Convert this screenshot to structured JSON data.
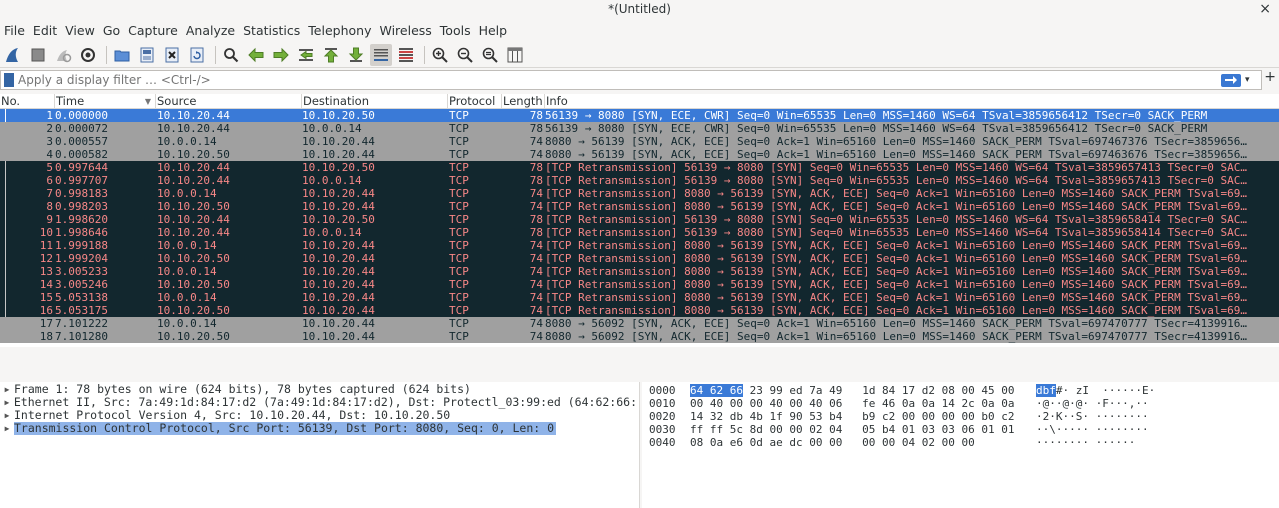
{
  "window": {
    "title": "*(Untitled)",
    "close": "×"
  },
  "menu": [
    "File",
    "Edit",
    "View",
    "Go",
    "Capture",
    "Analyze",
    "Statistics",
    "Telephony",
    "Wireless",
    "Tools",
    "Help"
  ],
  "toolbar": {
    "icons": [
      "shark-fin-start-icon",
      "stop-square-icon",
      "restart-capture-icon",
      "capture-options-gear-icon",
      "open-folder-icon",
      "save-file-icon",
      "close-file-icon",
      "reload-file-icon",
      "find-packet-icon",
      "go-back-arrow-icon",
      "go-forward-arrow-icon",
      "go-to-packet-icon",
      "go-first-packet-icon",
      "go-last-packet-icon",
      "auto-scroll-icon",
      "colorize-list-icon",
      "zoom-in-icon",
      "zoom-out-icon",
      "zoom-normal-icon",
      "resize-columns-icon"
    ]
  },
  "filter": {
    "placeholder": "Apply a display filter … <Ctrl-/>",
    "plus": "+"
  },
  "columns": {
    "no": "No.",
    "time": "Time",
    "source": "Source",
    "destination": "Destination",
    "protocol": "Protocol",
    "length": "Length",
    "info": "Info"
  },
  "colors": {
    "selected_bg": "#3a7ad7",
    "normal_bg": "#a0a0a0",
    "bad_bg": "#12272e",
    "bad_fg": "#f78787"
  },
  "packets": [
    {
      "no": "1",
      "time": "0.000000",
      "src": "10.10.20.44",
      "dst": "10.10.20.50",
      "proto": "TCP",
      "len": "78",
      "info": "56139 → 8080 [SYN, ECE, CWR] Seq=0 Win=65535 Len=0 MSS=1460 WS=64 TSval=3859656412 TSecr=0 SACK_PERM",
      "style": "selected"
    },
    {
      "no": "2",
      "time": "0.000072",
      "src": "10.10.20.44",
      "dst": "10.0.0.14",
      "proto": "TCP",
      "len": "78",
      "info": "56139 → 8080 [SYN, ECE, CWR] Seq=0 Win=65535 Len=0 MSS=1460 WS=64 TSval=3859656412 TSecr=0 SACK_PERM",
      "style": "normal"
    },
    {
      "no": "3",
      "time": "0.000557",
      "src": "10.0.0.14",
      "dst": "10.10.20.44",
      "proto": "TCP",
      "len": "74",
      "info": "8080 → 56139 [SYN, ACK, ECE] Seq=0 Ack=1 Win=65160 Len=0 MSS=1460 SACK_PERM TSval=697467376 TSecr=3859656…",
      "style": "normal"
    },
    {
      "no": "4",
      "time": "0.000582",
      "src": "10.10.20.50",
      "dst": "10.10.20.44",
      "proto": "TCP",
      "len": "74",
      "info": "8080 → 56139 [SYN, ACK, ECE] Seq=0 Ack=1 Win=65160 Len=0 MSS=1460 SACK_PERM TSval=697463676 TSecr=3859656…",
      "style": "normal"
    },
    {
      "no": "5",
      "time": "0.997644",
      "src": "10.10.20.44",
      "dst": "10.10.20.50",
      "proto": "TCP",
      "len": "78",
      "info": "[TCP Retransmission] 56139 → 8080 [SYN] Seq=0 Win=65535 Len=0 MSS=1460 WS=64 TSval=3859657413 TSecr=0 SAC…",
      "style": "bad"
    },
    {
      "no": "6",
      "time": "0.997707",
      "src": "10.10.20.44",
      "dst": "10.0.0.14",
      "proto": "TCP",
      "len": "78",
      "info": "[TCP Retransmission] 56139 → 8080 [SYN] Seq=0 Win=65535 Len=0 MSS=1460 WS=64 TSval=3859657413 TSecr=0 SAC…",
      "style": "bad"
    },
    {
      "no": "7",
      "time": "0.998183",
      "src": "10.0.0.14",
      "dst": "10.10.20.44",
      "proto": "TCP",
      "len": "74",
      "info": "[TCP Retransmission] 8080 → 56139 [SYN, ACK, ECE] Seq=0 Ack=1 Win=65160 Len=0 MSS=1460 SACK_PERM TSval=69…",
      "style": "bad"
    },
    {
      "no": "8",
      "time": "0.998203",
      "src": "10.10.20.50",
      "dst": "10.10.20.44",
      "proto": "TCP",
      "len": "74",
      "info": "[TCP Retransmission] 8080 → 56139 [SYN, ACK, ECE] Seq=0 Ack=1 Win=65160 Len=0 MSS=1460 SACK_PERM TSval=69…",
      "style": "bad"
    },
    {
      "no": "9",
      "time": "1.998620",
      "src": "10.10.20.44",
      "dst": "10.10.20.50",
      "proto": "TCP",
      "len": "78",
      "info": "[TCP Retransmission] 56139 → 8080 [SYN] Seq=0 Win=65535 Len=0 MSS=1460 WS=64 TSval=3859658414 TSecr=0 SAC…",
      "style": "bad"
    },
    {
      "no": "10",
      "time": "1.998646",
      "src": "10.10.20.44",
      "dst": "10.0.0.14",
      "proto": "TCP",
      "len": "78",
      "info": "[TCP Retransmission] 56139 → 8080 [SYN] Seq=0 Win=65535 Len=0 MSS=1460 WS=64 TSval=3859658414 TSecr=0 SAC…",
      "style": "bad"
    },
    {
      "no": "11",
      "time": "1.999188",
      "src": "10.0.0.14",
      "dst": "10.10.20.44",
      "proto": "TCP",
      "len": "74",
      "info": "[TCP Retransmission] 8080 → 56139 [SYN, ACK, ECE] Seq=0 Ack=1 Win=65160 Len=0 MSS=1460 SACK_PERM TSval=69…",
      "style": "bad"
    },
    {
      "no": "12",
      "time": "1.999204",
      "src": "10.10.20.50",
      "dst": "10.10.20.44",
      "proto": "TCP",
      "len": "74",
      "info": "[TCP Retransmission] 8080 → 56139 [SYN, ACK, ECE] Seq=0 Ack=1 Win=65160 Len=0 MSS=1460 SACK_PERM TSval=69…",
      "style": "bad"
    },
    {
      "no": "13",
      "time": "3.005233",
      "src": "10.0.0.14",
      "dst": "10.10.20.44",
      "proto": "TCP",
      "len": "74",
      "info": "[TCP Retransmission] 8080 → 56139 [SYN, ACK, ECE] Seq=0 Ack=1 Win=65160 Len=0 MSS=1460 SACK_PERM TSval=69…",
      "style": "bad"
    },
    {
      "no": "14",
      "time": "3.005246",
      "src": "10.10.20.50",
      "dst": "10.10.20.44",
      "proto": "TCP",
      "len": "74",
      "info": "[TCP Retransmission] 8080 → 56139 [SYN, ACK, ECE] Seq=0 Ack=1 Win=65160 Len=0 MSS=1460 SACK_PERM TSval=69…",
      "style": "bad"
    },
    {
      "no": "15",
      "time": "5.053138",
      "src": "10.0.0.14",
      "dst": "10.10.20.44",
      "proto": "TCP",
      "len": "74",
      "info": "[TCP Retransmission] 8080 → 56139 [SYN, ACK, ECE] Seq=0 Ack=1 Win=65160 Len=0 MSS=1460 SACK_PERM TSval=69…",
      "style": "bad"
    },
    {
      "no": "16",
      "time": "5.053175",
      "src": "10.10.20.50",
      "dst": "10.10.20.44",
      "proto": "TCP",
      "len": "74",
      "info": "[TCP Retransmission] 8080 → 56139 [SYN, ACK, ECE] Seq=0 Ack=1 Win=65160 Len=0 MSS=1460 SACK_PERM TSval=69…",
      "style": "bad"
    },
    {
      "no": "17",
      "time": "7.101222",
      "src": "10.0.0.14",
      "dst": "10.10.20.44",
      "proto": "TCP",
      "len": "74",
      "info": "8080 → 56092 [SYN, ACK, ECE] Seq=0 Ack=1 Win=65160 Len=0 MSS=1460 SACK_PERM TSval=697470777 TSecr=4139916…",
      "style": "normal"
    },
    {
      "no": "18",
      "time": "7.101280",
      "src": "10.10.20.50",
      "dst": "10.10.20.44",
      "proto": "TCP",
      "len": "74",
      "info": "8080 → 56092 [SYN, ACK, ECE] Seq=0 Ack=1 Win=65160 Len=0 MSS=1460 SACK_PERM TSval=697470777 TSecr=4139916…",
      "style": "normal"
    }
  ],
  "details": [
    {
      "text": "Frame 1: 78 bytes on wire (624 bits), 78 bytes captured (624 bits)",
      "selected": false
    },
    {
      "text": "Ethernet II, Src: 7a:49:1d:84:17:d2 (7a:49:1d:84:17:d2), Dst: Protectl_03:99:ed (64:62:66:",
      "selected": false
    },
    {
      "text": "Internet Protocol Version 4, Src: 10.10.20.44, Dst: 10.10.20.50",
      "selected": false
    },
    {
      "text": "Transmission Control Protocol, Src Port: 56139, Dst Port: 8080, Seq: 0, Len: 0",
      "selected": true
    }
  ],
  "bytes": [
    {
      "off": "0000",
      "hex_hl": "64 62 66",
      "hex": " 23 99 ed 7a 49   1d 84 17 d2 08 00 45 00",
      "ascii_hl": "dbf",
      "ascii": "#· zI  ······E·"
    },
    {
      "off": "0010",
      "hex_hl": "",
      "hex": "00 40 00 00 40 00 40 06   fe 46 0a 0a 14 2c 0a 0a",
      "ascii_hl": "",
      "ascii": "·@··@·@· ·F···,··"
    },
    {
      "off": "0020",
      "hex_hl": "",
      "hex": "14 32 db 4b 1f 90 53 b4   b9 c2 00 00 00 00 b0 c2",
      "ascii_hl": "",
      "ascii": "·2·K··S· ········"
    },
    {
      "off": "0030",
      "hex_hl": "",
      "hex": "ff ff 5c 8d 00 00 02 04   05 b4 01 03 03 06 01 01",
      "ascii_hl": "",
      "ascii": "··\\····· ········"
    },
    {
      "off": "0040",
      "hex_hl": "",
      "hex": "08 0a e6 0d ae dc 00 00   00 00 04 02 00 00",
      "ascii_hl": "",
      "ascii": "········ ······"
    }
  ]
}
